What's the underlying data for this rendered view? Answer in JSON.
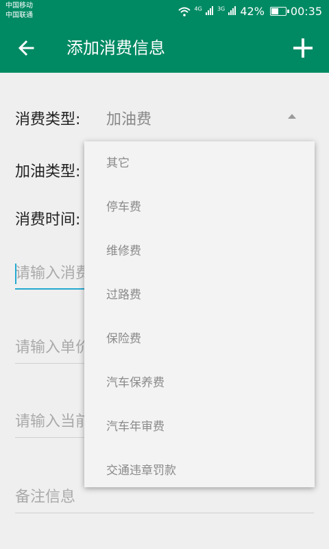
{
  "status": {
    "carrier1": "中国移动",
    "carrier2": "中国联通",
    "net1": "4G",
    "net2": "3G",
    "battery": "42%",
    "time": "00:35"
  },
  "appbar": {
    "title": "添加消费信息"
  },
  "form": {
    "expense_type_label": "消费类型:",
    "expense_type_value": "加油费",
    "fuel_type_label": "加油类型:",
    "expense_time_label": "消费时间:",
    "amount_placeholder": "请输入消费",
    "unit_price_placeholder": "请输入单价",
    "current_placeholder": "请输入当前",
    "remark_placeholder": "备注信息"
  },
  "dropdown": {
    "options": [
      "其它",
      "停车费",
      "维修费",
      "过路费",
      "保险费",
      "汽车保养费",
      "汽车年审费",
      "交通违章罚款"
    ]
  },
  "colors": {
    "primary": "#008a63",
    "accent": "#22a9d1",
    "background": "#efefef"
  },
  "icons": {
    "back": "arrow-left-icon",
    "add": "plus-icon"
  }
}
